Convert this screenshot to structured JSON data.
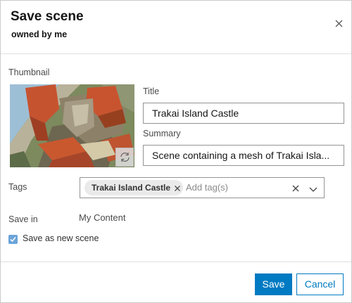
{
  "dialog": {
    "title": "Save scene",
    "subtitle": "owned by me",
    "close_icon": "close-icon"
  },
  "form": {
    "thumbnail_label": "Thumbnail",
    "title_label": "Title",
    "title_value": "Trakai Island Castle",
    "summary_label": "Summary",
    "summary_value": "Scene containing a mesh of Trakai Isla...",
    "tags_label": "Tags",
    "tags": [
      "Trakai Island Castle"
    ],
    "tags_placeholder": "Add tag(s)",
    "save_in_label": "Save in",
    "save_in_value": "My Content",
    "save_as_new_label": "Save as new scene",
    "save_as_new_checked": true
  },
  "footer": {
    "save_label": "Save",
    "cancel_label": "Cancel"
  },
  "colors": {
    "accent": "#007ac2",
    "checkbox": "#6ba4d8"
  }
}
